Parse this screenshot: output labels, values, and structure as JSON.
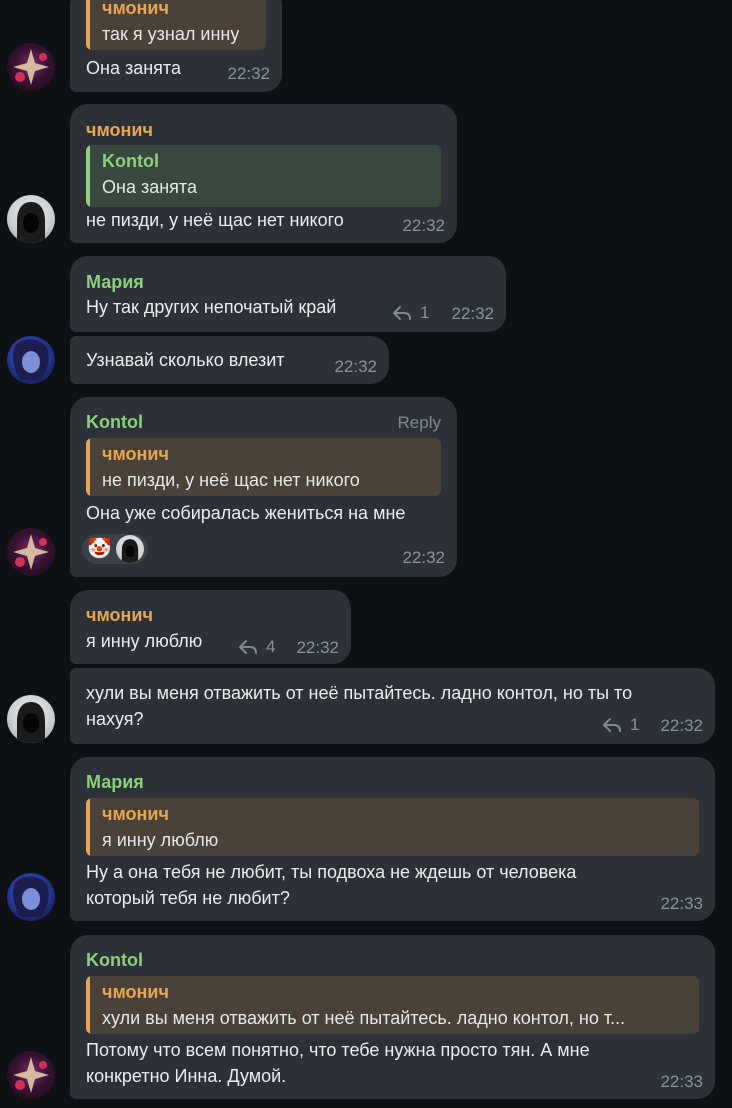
{
  "messages": {
    "m1": {
      "quote_author": "чмонич",
      "quote_text": "так я узнал инну",
      "text": "Она занята",
      "time": "22:32"
    },
    "m2": {
      "author": "чмонич",
      "quote_author": "Kontol",
      "quote_text": "Она занята",
      "text": "не пизди, у неё щас нет никого",
      "time": "22:32"
    },
    "m3": {
      "author": "Мария",
      "text": "Ну так других непочатый край",
      "reply_count": "1",
      "time": "22:32"
    },
    "m4": {
      "text": "Узнавай сколько влезит",
      "time": "22:32"
    },
    "m5": {
      "author": "Kontol",
      "reply_label": "Reply",
      "quote_author": "чмонич",
      "quote_text": "не пизди, у неё щас нет никого",
      "text": "Она уже собиралась жениться на мне",
      "reaction_emoji": "🤡",
      "time": "22:32"
    },
    "m6": {
      "author": "чмонич",
      "text": "я инну люблю",
      "reply_count": "4",
      "time": "22:32"
    },
    "m7": {
      "text_line1": "хули вы меня отважить от неё пытайтесь. ладно контол, но ты то",
      "text_line2": "нахуя?",
      "reply_count": "1",
      "time": "22:32"
    },
    "m8": {
      "author": "Мария",
      "quote_author": "чмонич",
      "quote_text": "я инну люблю",
      "text_line1": "Ну а она тебя не любит, ты подвоха не ждешь от человека",
      "text_line2": "который тебя не любит?",
      "time": "22:33"
    },
    "m9": {
      "author": "Kontol",
      "quote_author": "чмонич",
      "quote_text": "хули вы меня отважить от неё пытайтесь. ладно контол, но т...",
      "text_line1": "Потому что всем понятно, что тебе нужна просто тян. А мне",
      "text_line2": "конкретно Инна. Думой.",
      "time": "22:33"
    }
  }
}
